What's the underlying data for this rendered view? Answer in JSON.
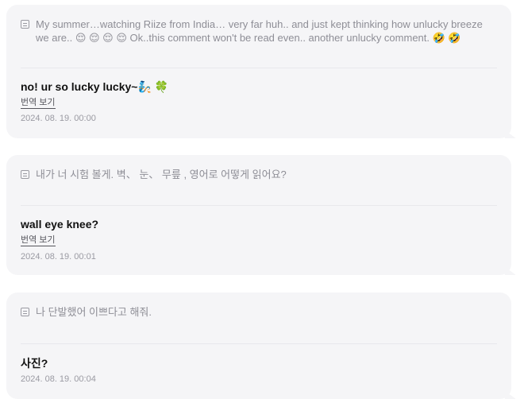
{
  "cards": [
    {
      "question": "My summer…watching Riize from India… very far huh.. and just kept thinking how unlucky breeze we are.. 😌 😌 😌 😌 Ok..this comment won't be read even.. another unlucky comment. 🤣 🤣",
      "answer": "no! ur so lucky lucky~🧞 🍀",
      "translate": "번역 보기",
      "date": "2024. 08. 19. 00:00"
    },
    {
      "question": "내가 너 시험 볼게. 벽、 눈、 무릎 , 영어로 어떻게 읽어요?",
      "answer": "wall eye knee?",
      "translate": "번역 보기",
      "date": "2024. 08. 19. 00:01"
    },
    {
      "question": "나 단발했어 이쁘다고 해줘.",
      "answer": "사진?",
      "date": "2024. 08. 19. 00:04"
    }
  ],
  "icons": {
    "question": "memo-icon"
  },
  "colors": {
    "card_bg": "#f5f5f7",
    "question_text": "#8e8e96",
    "answer_text": "#111111",
    "date_text": "#9a9aa2"
  }
}
